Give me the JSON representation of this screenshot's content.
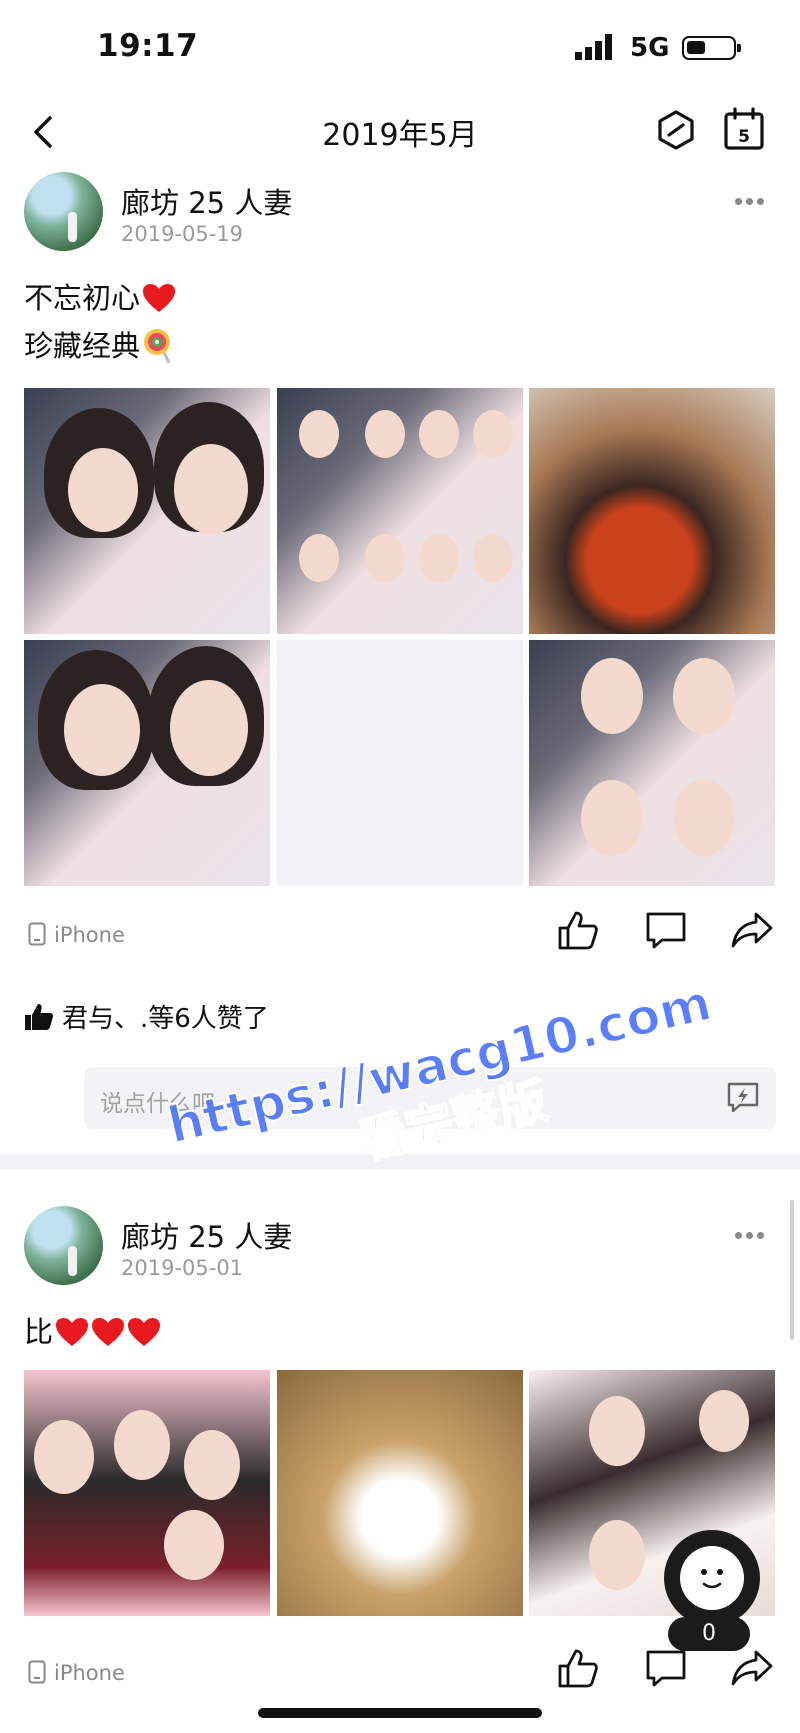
{
  "status": {
    "time": "19:17",
    "network": "5G"
  },
  "nav": {
    "title": "2019年5月"
  },
  "posts": [
    {
      "username": "廊坊 25 人妻",
      "date": "2019-05-19",
      "text_line1": "不忘初心",
      "text_line2": "珍藏经典",
      "device": "iPhone",
      "likes_text": "君与、.等6人赞了",
      "comment_placeholder": "说点什么吧..."
    },
    {
      "username": "廊坊 25 人妻",
      "date": "2019-05-01",
      "text_line1": "比",
      "device": "iPhone"
    }
  ],
  "watermark": {
    "url": "https://wacg10.com",
    "subtitle": "看完整版"
  },
  "float_count": "0",
  "colors": {
    "watermark": "#4e73ff",
    "heart": "#e8191f",
    "accent_text": "#111111"
  },
  "icons": [
    "back-icon",
    "hexagon-icon",
    "calendar-icon",
    "more-icon",
    "phone-icon",
    "like-icon",
    "comment-icon",
    "share-icon",
    "flash-icon"
  ]
}
